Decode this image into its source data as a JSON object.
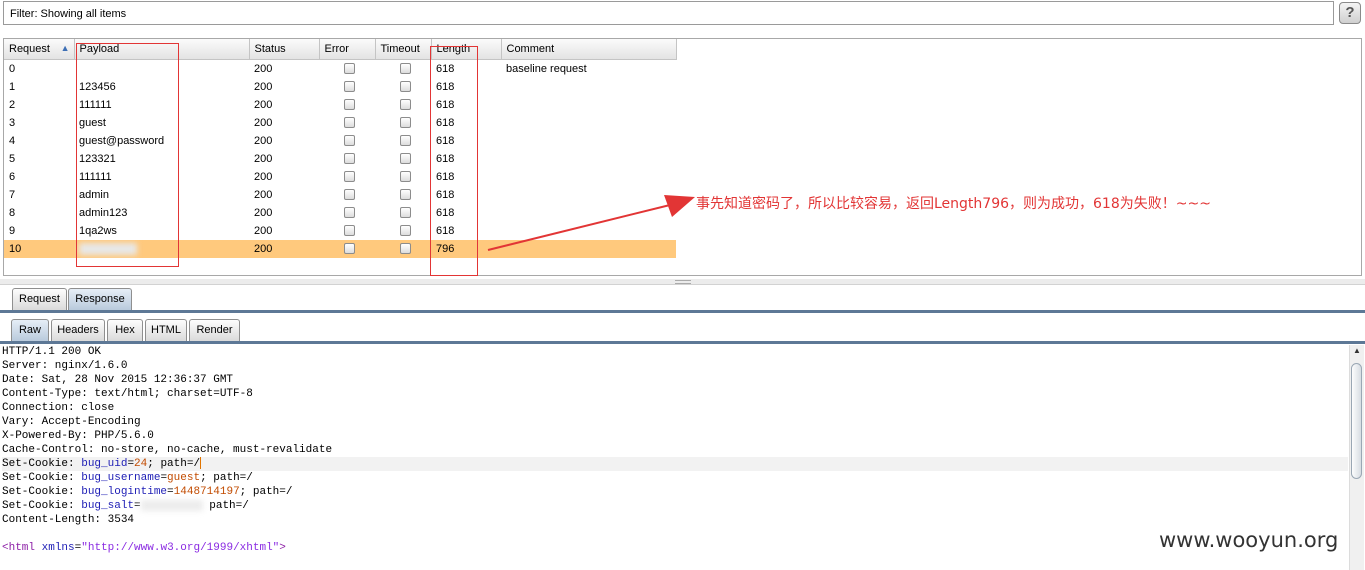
{
  "filter": {
    "label": "Filter: Showing all items",
    "help": "?"
  },
  "table": {
    "columns": [
      "Request",
      "Payload",
      "Status",
      "Error",
      "Timeout",
      "Length",
      "Comment"
    ],
    "rows": [
      {
        "request": "0",
        "payload": "",
        "status": "200",
        "length": "618",
        "comment": "baseline request"
      },
      {
        "request": "1",
        "payload": "123456",
        "status": "200",
        "length": "618",
        "comment": ""
      },
      {
        "request": "2",
        "payload": "111111",
        "status": "200",
        "length": "618",
        "comment": ""
      },
      {
        "request": "3",
        "payload": "guest",
        "status": "200",
        "length": "618",
        "comment": ""
      },
      {
        "request": "4",
        "payload": "guest@password",
        "status": "200",
        "length": "618",
        "comment": ""
      },
      {
        "request": "5",
        "payload": "123321",
        "status": "200",
        "length": "618",
        "comment": ""
      },
      {
        "request": "6",
        "payload": "111111",
        "status": "200",
        "length": "618",
        "comment": ""
      },
      {
        "request": "7",
        "payload": "admin",
        "status": "200",
        "length": "618",
        "comment": ""
      },
      {
        "request": "8",
        "payload": "admin123",
        "status": "200",
        "length": "618",
        "comment": ""
      },
      {
        "request": "9",
        "payload": "1qa2ws",
        "status": "200",
        "length": "618",
        "comment": ""
      },
      {
        "request": "10",
        "payload": "",
        "status": "200",
        "length": "796",
        "comment": ""
      }
    ]
  },
  "annotation": "事先知道密码了，所以比较容易，返回Length796，则为成功，618为失败！~~~",
  "tabs_outer": [
    "Request",
    "Response"
  ],
  "tabs_inner": [
    "Raw",
    "Headers",
    "Hex",
    "HTML",
    "Render"
  ],
  "response": {
    "lines": [
      "HTTP/1.1 200 OK",
      "Server: nginx/1.6.0",
      "Date: Sat, 28 Nov 2015 12:36:37 GMT",
      "Content-Type: text/html; charset=UTF-8",
      "Connection: close",
      "Vary: Accept-Encoding",
      "X-Powered-By: PHP/5.6.0",
      "Cache-Control: no-store, no-cache, must-revalidate"
    ],
    "cookies": [
      {
        "prefix": "Set-Cookie: ",
        "name": "bug_uid",
        "value": "24",
        "suffix": "; path=/"
      },
      {
        "prefix": "Set-Cookie: ",
        "name": "bug_username",
        "value": "guest",
        "suffix": "; path=/"
      },
      {
        "prefix": "Set-Cookie: ",
        "name": "bug_logintime",
        "value": "1448714197",
        "suffix": "; path=/"
      },
      {
        "prefix": "Set-Cookie: ",
        "name": "bug_salt",
        "value": "",
        "suffix": "path=/"
      }
    ],
    "content_length": "Content-Length: 3534",
    "html_tag": "<html",
    "html_attr": "xmlns",
    "html_value": "\"http://www.w3.org/1999/xhtml\"",
    "html_close": ">"
  },
  "watermark": "www.wooyun.org",
  "colors": {
    "accent": "#5d7896",
    "selected_row": "#ffc97d",
    "annotation": "#e23535"
  }
}
